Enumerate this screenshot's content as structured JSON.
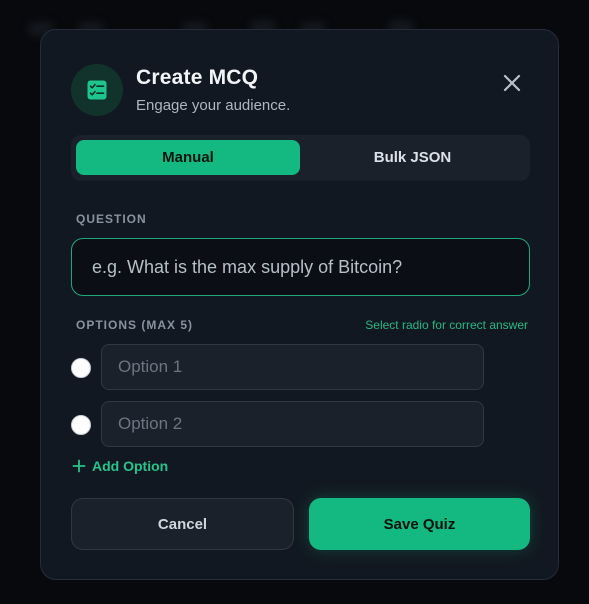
{
  "modal": {
    "title": "Create MCQ",
    "subtitle": "Engage your audience."
  },
  "tabs": [
    {
      "label": "Manual",
      "active": true
    },
    {
      "label": "Bulk JSON",
      "active": false
    }
  ],
  "question": {
    "label": "QUESTION",
    "placeholder": "e.g. What is the max supply of Bitcoin?",
    "value": ""
  },
  "options": {
    "label": "OPTIONS (MAX 5)",
    "hint": "Select radio for correct answer",
    "items": [
      {
        "placeholder": "Option 1",
        "value": "",
        "checked": false
      },
      {
        "placeholder": "Option 2",
        "value": "",
        "checked": false
      }
    ],
    "add_label": "Add Option"
  },
  "actions": {
    "cancel_label": "Cancel",
    "save_label": "Save Quiz"
  },
  "icons": {
    "header": "quiz-checklist-icon",
    "close": "close-icon",
    "add": "plus-icon"
  },
  "colors": {
    "accent": "#14b981",
    "modal_bg": "#121821",
    "page_bg": "#07090d"
  }
}
